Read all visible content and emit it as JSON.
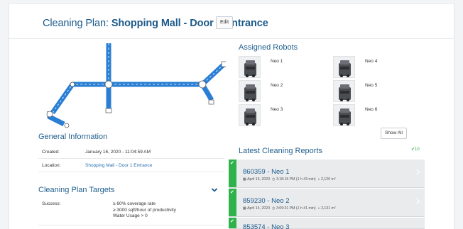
{
  "header": {
    "title_prefix": "Cleaning Plan: ",
    "title_name": "Shopping Mall - Door 1 Entrance",
    "edit_label": "Edit"
  },
  "general_info": {
    "title": "General Information",
    "rows": [
      {
        "label": "Created:",
        "value": "January 16, 2020 - 11:04:59 AM"
      },
      {
        "label": "Location:",
        "value": "Shopping Mall - Door 1 Entrance"
      }
    ]
  },
  "targets": {
    "title": "Cleaning Plan Targets",
    "label": "Success:",
    "lines": [
      "≥ 60% coverage rate",
      "≥ 3000 sqft/hour of productivity",
      "Water Usage > 0"
    ]
  },
  "robots": {
    "title": "Assigned Robots",
    "items": [
      "Neo 1",
      "Neo 2",
      "Neo 3",
      "Neo 4",
      "Neo 5",
      "Neo 6"
    ],
    "show_all_label": "Show All"
  },
  "reports": {
    "title": "Latest Cleaning Reports",
    "count": "✔10",
    "items": [
      {
        "title": "860359 - Neo 1",
        "date": "April 15, 2020",
        "time": "3:18:15 PM (1 h 43 min)",
        "area": "2,120 m²"
      },
      {
        "title": "859230 - Neo 2",
        "date": "April 14, 2020",
        "time": "3:09:31 PM (1 h 41 min)",
        "area": "2,131 m²"
      },
      {
        "title": "853574 - Neo 3",
        "date": "",
        "time": "",
        "area": ""
      }
    ]
  },
  "colors": {
    "accent": "#1c5a8a",
    "success": "#2fb24c",
    "path": "#2a7fd4"
  }
}
